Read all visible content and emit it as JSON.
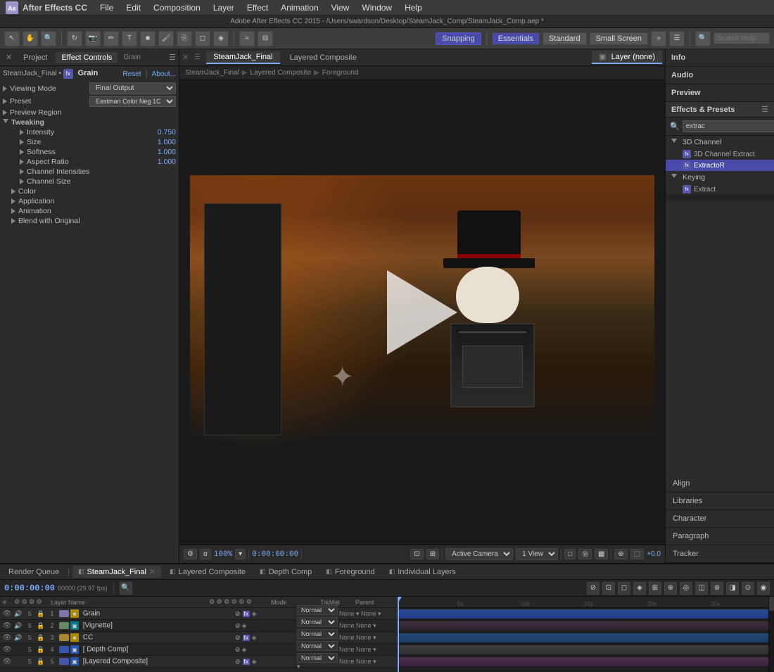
{
  "app": {
    "name": "After Effects CC",
    "version": "Adobe After Effects CC 2015",
    "filepath": "Adobe After Effects CC 2015 - /Users/swardson/Desktop/SteamJack_Comp/SteamJack_Comp.aep *"
  },
  "menu": {
    "items": [
      "File",
      "Edit",
      "Composition",
      "Layer",
      "Effect",
      "Animation",
      "View",
      "Window",
      "Help"
    ]
  },
  "toolbar": {
    "snapping_label": "Snapping",
    "workspaces": [
      "Essentials",
      "Standard",
      "Small Screen"
    ],
    "search_placeholder": "Search Help"
  },
  "left_panel": {
    "tabs": [
      "Project",
      "Effect Controls"
    ],
    "active_tab": "Effect Controls",
    "effect_controls": {
      "title": "Grain",
      "layer": "SteamJack_Final",
      "reset_label": "Reset",
      "about_label": "About...",
      "viewing_mode_label": "Viewing Mode",
      "viewing_mode_value": "Final Output",
      "preset_label": "Preset",
      "preset_value": "Eastman Color Neg 1C",
      "preview_region_label": "Preview Region",
      "tweaking_label": "Tweaking",
      "intensity_label": "Intensity",
      "intensity_value": "0.750",
      "size_label": "Size",
      "size_value": "1.000",
      "softness_label": "Softness",
      "softness_value": "1.000",
      "aspect_ratio_label": "Aspect Ratio",
      "aspect_ratio_value": "1.000",
      "channel_intensities_label": "Channel Intensities",
      "channel_size_label": "Channel Size",
      "color_label": "Color",
      "application_label": "Application",
      "animation_label": "Animation",
      "blend_label": "Blend with Original"
    }
  },
  "composition": {
    "tabs": [
      "SteamJack_Final",
      "Layered Composite"
    ],
    "active_tab": "SteamJack_Final",
    "breadcrumbs": [
      "SteamJack_Final",
      "Layered Composite",
      "Foreground"
    ],
    "layer_label": "Layer (none)",
    "timecode": "0:00:00:00",
    "zoom_level": "100%",
    "active_camera": "Active Camera",
    "views": "1 View",
    "exposure": "+0.0"
  },
  "right_panel": {
    "sections": [
      "Info",
      "Audio",
      "Preview"
    ],
    "effects_presets_title": "Effects & Presets",
    "search_value": "extrac",
    "categories": [
      {
        "name": "3D Channel",
        "expanded": true,
        "items": [
          "3D Channel Extract",
          "ExtractoR"
        ]
      },
      {
        "name": "Keying",
        "expanded": true,
        "items": [
          "Extract"
        ]
      }
    ],
    "bottom_sections": [
      "Align",
      "Libraries",
      "Character",
      "Paragraph",
      "Tracker"
    ]
  },
  "timeline": {
    "tabs": [
      "Render Queue",
      "SteamJack_Final",
      "Layered Composite",
      "Depth Comp",
      "Foreground",
      "Individual Layers"
    ],
    "active_tab": "SteamJack_Final",
    "timecode": "0:00:00:00",
    "fps": "00000 (29.97 fps)",
    "columns": {
      "name": "Layer Name",
      "mode": "Mode",
      "trkmat": "TrkMat",
      "parent": "Parent"
    },
    "layers": [
      {
        "num": "1",
        "name": "Grain",
        "color": "#7777aa",
        "has_fx": true,
        "mode": "Normal",
        "trkmat": "None",
        "parent": "None",
        "type": "solid"
      },
      {
        "num": "2",
        "name": "[Vignette]",
        "color": "#668866",
        "has_fx": false,
        "mode": "Normal",
        "trkmat": "None",
        "parent": "None",
        "type": "comp"
      },
      {
        "num": "3",
        "name": "CC",
        "color": "#aa8833",
        "has_fx": true,
        "mode": "Normal",
        "trkmat": "None",
        "parent": "None",
        "type": "solid"
      },
      {
        "num": "4",
        "name": "[ Depth Comp]",
        "color": "#3355aa",
        "has_fx": false,
        "mode": "Normal",
        "trkmat": "None",
        "parent": "None",
        "type": "comp"
      },
      {
        "num": "5",
        "name": "[Layered Composite]",
        "color": "#4455aa",
        "has_fx": true,
        "mode": "Normal",
        "trkmat": "None",
        "parent": "None",
        "type": "comp"
      }
    ],
    "ruler_marks": [
      "5s",
      "10s",
      "15s",
      "20s",
      "25s"
    ]
  }
}
